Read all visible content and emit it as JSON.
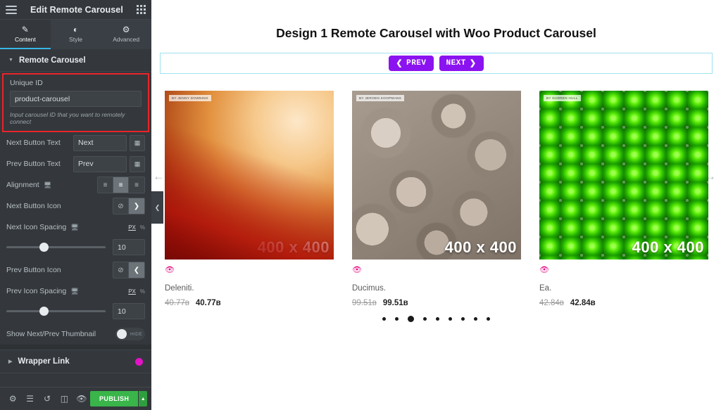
{
  "panel": {
    "title": "Edit Remote Carousel",
    "menu_icon": "hamburger-icon",
    "apps_icon": "grid-icon",
    "tabs": [
      {
        "label": "Content",
        "icon": "pencil-icon",
        "active": true
      },
      {
        "label": "Style",
        "icon": "contrast-icon",
        "active": false
      },
      {
        "label": "Advanced",
        "icon": "gear-icon",
        "active": false
      }
    ],
    "section": {
      "label": "Remote Carousel",
      "expanded": true
    },
    "controls": {
      "unique_id": {
        "label": "Unique ID",
        "value": "product-carousel",
        "placeholder": "",
        "hint": "Input carousel ID that you want to remotely connect"
      },
      "next_button_text": {
        "label": "Next Button Text",
        "value": "Next"
      },
      "prev_button_text": {
        "label": "Prev Button Text",
        "value": "Prev"
      },
      "alignment": {
        "label": "Alignment",
        "options": [
          "left",
          "center",
          "right"
        ],
        "selected": "center"
      },
      "next_button_icon": {
        "label": "Next Button Icon",
        "options": [
          "none",
          "chevron-right"
        ],
        "selected": "chevron-right"
      },
      "next_icon_spacing": {
        "label": "Next Icon Spacing",
        "value": "10",
        "units": [
          "PX",
          "%"
        ],
        "unit_selected": "PX"
      },
      "prev_button_icon": {
        "label": "Prev Button Icon",
        "options": [
          "none",
          "chevron-left"
        ],
        "selected": "chevron-left"
      },
      "prev_icon_spacing": {
        "label": "Prev Icon Spacing",
        "value": "10",
        "units": [
          "PX",
          "%"
        ],
        "unit_selected": "PX"
      },
      "show_thumbnail": {
        "label": "Show Next/Prev Thumbnail",
        "state": "off",
        "state_label": "HIDE"
      }
    },
    "wrapper_link": {
      "label": "Wrapper Link",
      "pro_badge": true
    },
    "footer": {
      "icons": [
        "settings-gear-icon",
        "layers-icon",
        "history-icon",
        "responsive-preview-icon",
        "preview-eye-icon"
      ],
      "publish_label": "PUBLISH",
      "publish_arrow": "chevron-up-icon"
    }
  },
  "canvas": {
    "page_title": "Design 1 Remote Carousel with Woo Product Carousel",
    "nav": {
      "prev_label": "PREV",
      "next_label": "NEXT",
      "prev_icon": "chevron-left-icon",
      "next_icon": "chevron-right-icon"
    },
    "arrows": {
      "left": "arrow-left-icon",
      "right": "arrow-right-icon"
    },
    "products": [
      {
        "badge": "BY JENNY DOWNING",
        "dimensions": "400 x 400",
        "title": "Deleniti.",
        "price_old": "40.77в",
        "price_new": "40.77в",
        "quick_view_icon": "eye-icon",
        "image": "img1"
      },
      {
        "badge": "BY JEROEN KOOPMANS",
        "dimensions": "400 x 400",
        "title": "Ducimus.",
        "price_old": "99.51в",
        "price_new": "99.51в",
        "quick_view_icon": "eye-icon",
        "image": "img2"
      },
      {
        "badge": "BY DARREN HULL",
        "dimensions": "400 x 400",
        "title": "Ea.",
        "price_old": "42.84в",
        "price_new": "42.84в",
        "quick_view_icon": "eye-icon",
        "image": "img3"
      }
    ],
    "pagination": {
      "count": 9,
      "active_index": 2
    }
  },
  "colors": {
    "panel_bg": "#34383c",
    "accent_blue": "#39b5e6",
    "highlight_red": "#e8242a",
    "publish_green": "#39b54a",
    "nav_purple": "#8b13f0",
    "nav_border": "#9fe2ef",
    "pro_pink": "#e212c6",
    "quick_view_pink": "#e5007d"
  }
}
